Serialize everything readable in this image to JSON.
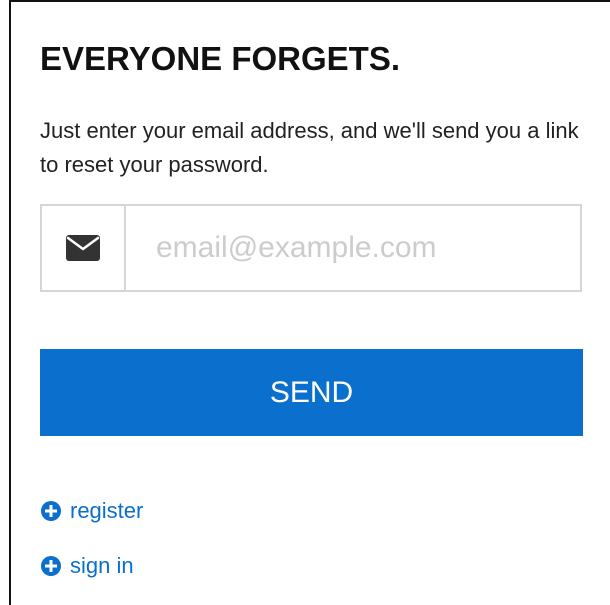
{
  "form": {
    "title": "EVERYONE FORGETS.",
    "intro": "Just enter your email address, and we'll send you a link to reset your password.",
    "email": {
      "icon": "envelope-icon",
      "placeholder": "email@example.com",
      "value": ""
    },
    "send_label": "SEND"
  },
  "links": {
    "register": {
      "icon": "plus-circle-icon",
      "label": "register"
    },
    "sign_in": {
      "icon": "plus-circle-icon",
      "label": "sign in"
    }
  },
  "colors": {
    "accent": "#0a6fcd",
    "title_text": "#111111",
    "body_text": "#222222",
    "input_border": "#d5d5d5",
    "placeholder": "#cccccc",
    "icon": "#333333"
  }
}
